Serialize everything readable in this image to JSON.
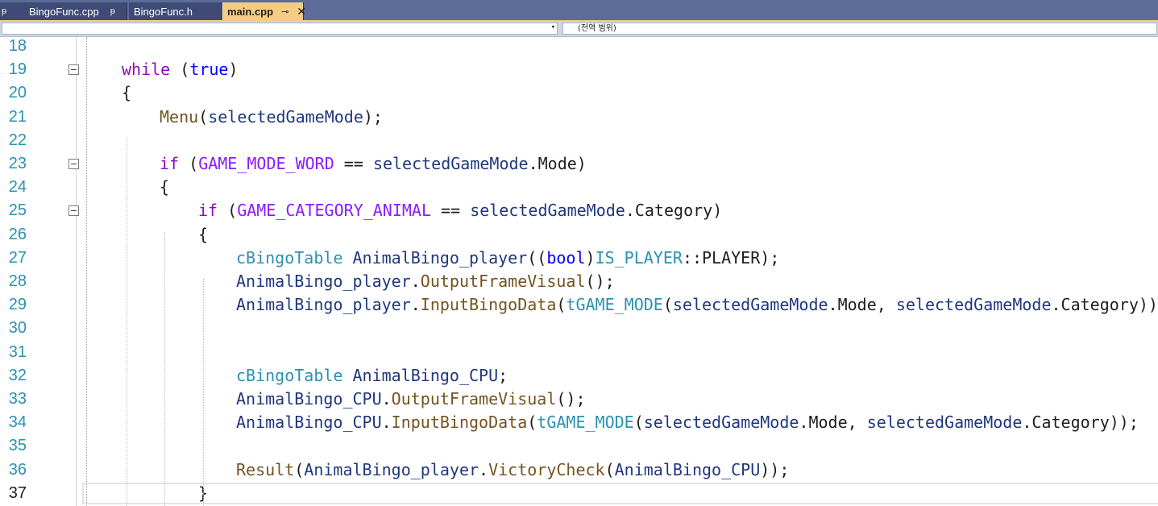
{
  "tabs": [
    {
      "label": "BingoFunc.cpp",
      "pin": "ᵽ"
    },
    {
      "label": "BingoFunc.h",
      "pin": ""
    },
    {
      "label": "main.cpp",
      "pin": "⊸",
      "close": "✕",
      "active": true
    }
  ],
  "tab_leading_pin": "ᵽ",
  "navbar": {
    "dropdown_arrow": "▾",
    "scope": "(전역 범위)"
  },
  "editor": {
    "current_line": 37,
    "lines": [
      {
        "n": "18"
      },
      {
        "n": "19",
        "fold": true,
        "tokens": [
          [
            "k",
            "while"
          ],
          [
            "p",
            " ("
          ],
          [
            "b",
            "true"
          ],
          [
            "p",
            ")"
          ]
        ]
      },
      {
        "n": "20",
        "tokens": [
          [
            "p",
            "{"
          ]
        ]
      },
      {
        "n": "21",
        "tokens": [
          [
            "f",
            "Menu"
          ],
          [
            "p",
            "("
          ],
          [
            "v",
            "selectedGameMode"
          ],
          [
            "p",
            ");"
          ]
        ]
      },
      {
        "n": "22"
      },
      {
        "n": "23",
        "fold": true,
        "tokens": [
          [
            "k",
            "if"
          ],
          [
            "p",
            " ("
          ],
          [
            "m",
            "GAME_MODE_WORD"
          ],
          [
            "p",
            " == "
          ],
          [
            "v",
            "selectedGameMode"
          ],
          [
            "p",
            ".Mode)"
          ]
        ]
      },
      {
        "n": "24",
        "tokens": [
          [
            "p",
            "{"
          ]
        ]
      },
      {
        "n": "25",
        "fold": true,
        "tokens": [
          [
            "k",
            "if"
          ],
          [
            "p",
            " ("
          ],
          [
            "m",
            "GAME_CATEGORY_ANIMAL"
          ],
          [
            "p",
            " == "
          ],
          [
            "v",
            "selectedGameMode"
          ],
          [
            "p",
            ".Category)"
          ]
        ]
      },
      {
        "n": "26",
        "tokens": [
          [
            "p",
            "{"
          ]
        ]
      },
      {
        "n": "27",
        "tokens": [
          [
            "t",
            "cBingoTable"
          ],
          [
            "p",
            " "
          ],
          [
            "v",
            "AnimalBingo_player"
          ],
          [
            "p",
            "(("
          ],
          [
            "b",
            "bool"
          ],
          [
            "p",
            ")"
          ],
          [
            "t",
            "IS_PLAYER"
          ],
          [
            "p",
            "::PLAYER);"
          ]
        ]
      },
      {
        "n": "28",
        "tokens": [
          [
            "v",
            "AnimalBingo_player"
          ],
          [
            "p",
            "."
          ],
          [
            "f",
            "OutputFrameVisual"
          ],
          [
            "p",
            "();"
          ]
        ]
      },
      {
        "n": "29",
        "tokens": [
          [
            "v",
            "AnimalBingo_player"
          ],
          [
            "p",
            "."
          ],
          [
            "f",
            "InputBingoData"
          ],
          [
            "p",
            "("
          ],
          [
            "t",
            "tGAME_MODE"
          ],
          [
            "p",
            "("
          ],
          [
            "v",
            "selectedGameMode"
          ],
          [
            "p",
            ".Mode, "
          ],
          [
            "v",
            "selectedGameMode"
          ],
          [
            "p",
            ".Category));"
          ]
        ]
      },
      {
        "n": "30"
      },
      {
        "n": "31"
      },
      {
        "n": "32",
        "tokens": [
          [
            "t",
            "cBingoTable"
          ],
          [
            "p",
            " "
          ],
          [
            "v",
            "AnimalBingo_CPU"
          ],
          [
            "p",
            ";"
          ]
        ]
      },
      {
        "n": "33",
        "tokens": [
          [
            "v",
            "AnimalBingo_CPU"
          ],
          [
            "p",
            "."
          ],
          [
            "f",
            "OutputFrameVisual"
          ],
          [
            "p",
            "();"
          ]
        ]
      },
      {
        "n": "34",
        "tokens": [
          [
            "v",
            "AnimalBingo_CPU"
          ],
          [
            "p",
            "."
          ],
          [
            "f",
            "InputBingoData"
          ],
          [
            "p",
            "("
          ],
          [
            "t",
            "tGAME_MODE"
          ],
          [
            "p",
            "("
          ],
          [
            "v",
            "selectedGameMode"
          ],
          [
            "p",
            ".Mode, "
          ],
          [
            "v",
            "selectedGameMode"
          ],
          [
            "p",
            ".Category));"
          ]
        ]
      },
      {
        "n": "35"
      },
      {
        "n": "36",
        "tokens": [
          [
            "f",
            "Result"
          ],
          [
            "p",
            "("
          ],
          [
            "v",
            "AnimalBingo_player"
          ],
          [
            "p",
            "."
          ],
          [
            "f",
            "VictoryCheck"
          ],
          [
            "p",
            "("
          ],
          [
            "v",
            "AnimalBingo_CPU"
          ],
          [
            "p",
            "));"
          ]
        ]
      },
      {
        "n": "37",
        "tokens": [
          [
            "p",
            "}"
          ]
        ]
      }
    ]
  },
  "colors": {
    "tab_strip": "#5d6b99",
    "active_tab": "#f5cc84",
    "line_number": "#2b91af",
    "keyword": "#8f08c4",
    "function": "#74531f",
    "type": "#2b91af",
    "macro": "#8a1bff",
    "variable": "#1f377f"
  }
}
